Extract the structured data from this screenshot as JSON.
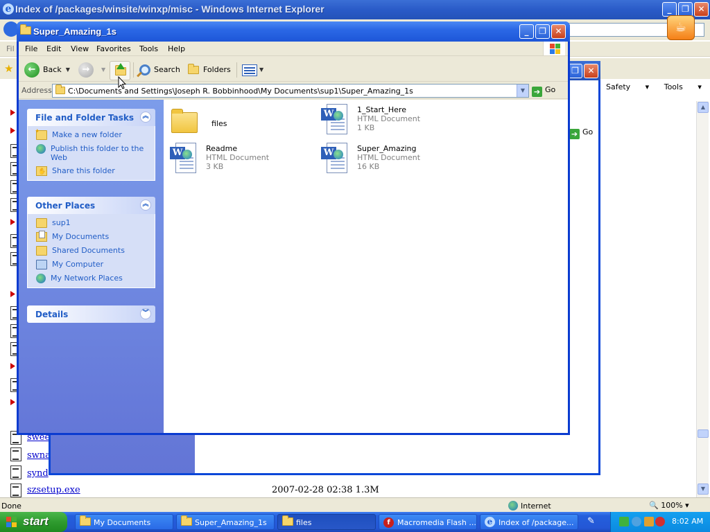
{
  "ie": {
    "title": "Index of /packages/winsite/winxp/misc - Windows Internet Explorer",
    "menu_partial": "Fil",
    "tools": {
      "safety": "Safety",
      "tools": "Tools",
      "help": "?"
    },
    "go_label": "Go",
    "files": [
      {
        "name": "swee"
      },
      {
        "name": "swna"
      },
      {
        "name": "synd"
      },
      {
        "name": "szsetup.exe"
      }
    ],
    "last_file_meta": "2007-02-28 02:38  1.3M",
    "status": {
      "text": "Done",
      "zone": "Internet",
      "zoom": "100%"
    }
  },
  "explorer": {
    "title": "Super_Amazing_1s",
    "menu": [
      "File",
      "Edit",
      "View",
      "Favorites",
      "Tools",
      "Help"
    ],
    "toolbar": {
      "back": "Back",
      "search": "Search",
      "folders": "Folders"
    },
    "address": {
      "label": "Address",
      "path": "C:\\Documents and Settings\\Joseph R. Bobbinhood\\My Documents\\sup1\\Super_Amazing_1s",
      "go": "Go"
    },
    "tasks": {
      "title": "File and Folder Tasks",
      "items": [
        "Make a new folder",
        "Publish this folder to the Web",
        "Share this folder"
      ]
    },
    "places": {
      "title": "Other Places",
      "items": [
        "sup1",
        "My Documents",
        "Shared Documents",
        "My Computer",
        "My Network Places"
      ]
    },
    "details": {
      "title": "Details"
    },
    "files": [
      {
        "name": "files",
        "type": "",
        "size": ""
      },
      {
        "name": "1_Start_Here",
        "type": "HTML Document",
        "size": "1 KB"
      },
      {
        "name": "Readme",
        "type": "HTML Document",
        "size": "3 KB"
      },
      {
        "name": "Super_Amazing",
        "type": "HTML Document",
        "size": "16 KB"
      }
    ]
  },
  "taskbar": {
    "start": "start",
    "tasks": [
      "My Documents",
      "Super_Amazing_1s",
      "files",
      "Macromedia Flash ...",
      "Index of /package..."
    ],
    "clock": "8:02 AM"
  }
}
